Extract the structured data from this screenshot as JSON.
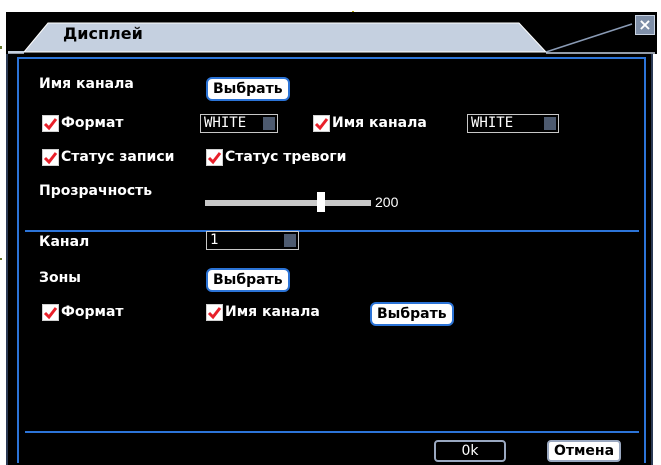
{
  "window": {
    "title": "Дисплей",
    "close_glyph": "×"
  },
  "section1": {
    "channel_name_label": "Имя канала",
    "channel_name_button": "Выбрать",
    "format_label": "Формат",
    "format_select_value": "WHITE",
    "channel_name_check_label": "Имя канала",
    "channel_name_select_value": "WHITE",
    "record_status_label": "Статус записи",
    "alarm_status_label": "Статус тревоги",
    "transparency_label": "Прозрачность",
    "transparency_value": "200"
  },
  "section2": {
    "channel_label": "Канал",
    "channel_select_value": "1",
    "zones_label": "Зоны",
    "zones_button": "Выбрать",
    "format_label": "Формат",
    "channel_name_label": "Имя канала",
    "channel_name_button": "Выбрать"
  },
  "footer": {
    "ok_label": "0k",
    "cancel_label": "Отмена"
  },
  "colors": {
    "accent": "#2c74d8",
    "check": "#e8202a",
    "title_bar": "#c5d0e0"
  }
}
